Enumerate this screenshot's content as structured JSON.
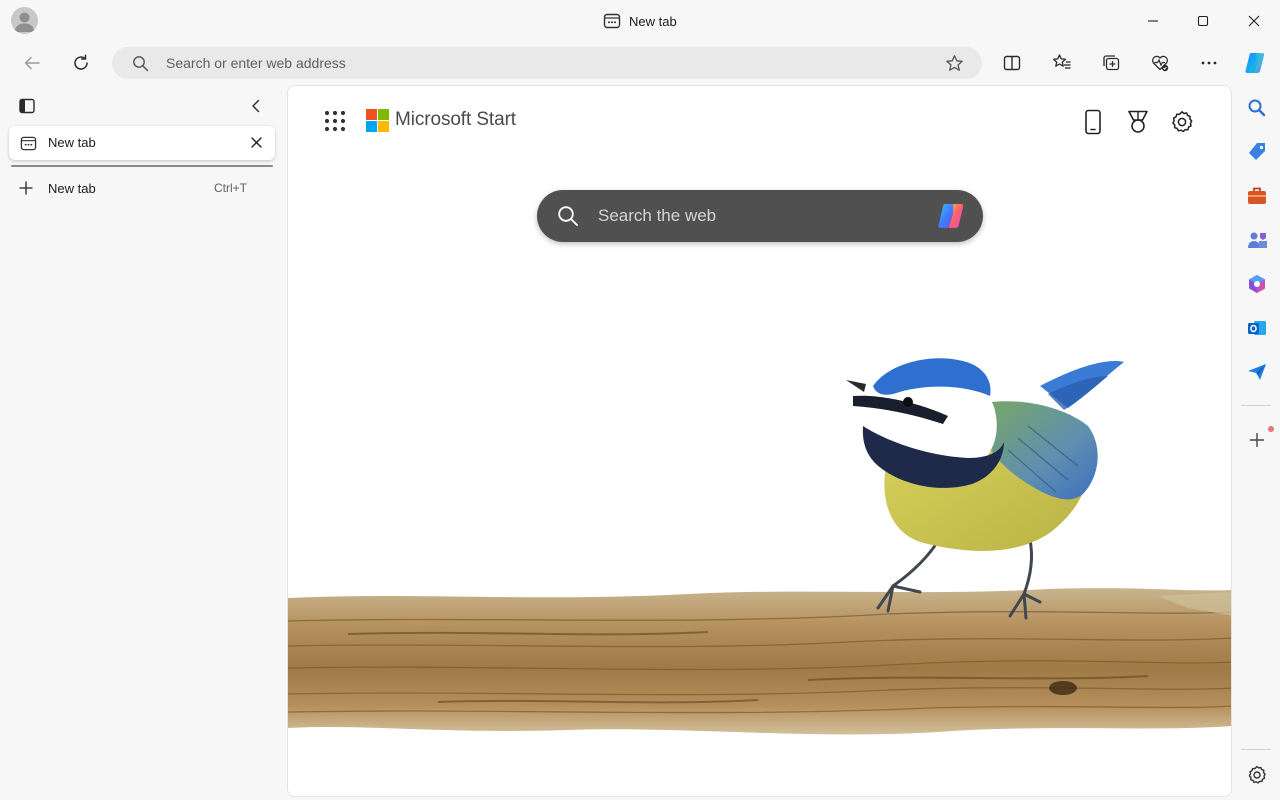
{
  "window": {
    "title": "New tab",
    "title_icon": "tab-page-icon",
    "controls": [
      "minimize-icon",
      "maximize-icon",
      "close-icon"
    ]
  },
  "toolbar": {
    "address_placeholder": "Search or enter web address",
    "icons": [
      "back-arrow-icon",
      "refresh-icon",
      "search-icon",
      "favorite-star-icon",
      "split-screen-icon",
      "favorites-icon",
      "collections-icon",
      "browser-essentials-icon",
      "more-icon",
      "copilot-icon"
    ]
  },
  "tab_panel": {
    "icons": [
      "tab-actions-icon",
      "collapse-panel-icon"
    ],
    "tabs": [
      {
        "label": "New tab",
        "icon": "tab-page-icon"
      }
    ],
    "new_tab": {
      "label": "New tab",
      "shortcut": "Ctrl+T"
    }
  },
  "start_page": {
    "brand": "Microsoft Start",
    "brand_colors": [
      "#f25022",
      "#7fba00",
      "#00a4ef",
      "#ffb900"
    ],
    "search_placeholder": "Search the web",
    "header_icons": [
      "apps-launcher-icon",
      "phone-icon",
      "rewards-icon",
      "settings-icon"
    ],
    "background": "blue-tit-bird-on-branch-image"
  },
  "right_sidebar": {
    "icons": [
      "search-icon",
      "shopping-tag-icon",
      "tools-icon",
      "games-icon",
      "microsoft-365-icon",
      "outlook-icon",
      "drop-send-icon",
      "add-icon",
      "sidebar-settings-icon"
    ]
  },
  "colors": {
    "chrome_bg": "#f7f7f7",
    "address_bg": "#e9e9e9",
    "search_bg": "#505050"
  }
}
